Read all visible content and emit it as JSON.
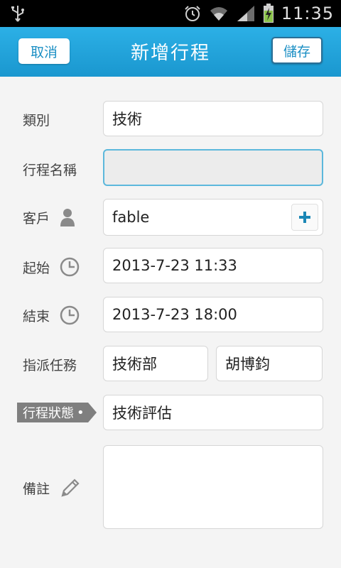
{
  "status_bar": {
    "time": "11:35",
    "icons": [
      "usb-icon",
      "alarm-icon",
      "wifi-icon",
      "signal-icon",
      "battery-charging-icon"
    ]
  },
  "action_bar": {
    "cancel_label": "取消",
    "title": "新增行程",
    "save_label": "儲存"
  },
  "form": {
    "category": {
      "label": "類別",
      "value": "技術"
    },
    "schedule_name": {
      "label": "行程名稱",
      "value": ""
    },
    "client": {
      "label": "客戶",
      "value": "fable"
    },
    "start": {
      "label": "起始",
      "value": "2013-7-23 11:33"
    },
    "end": {
      "label": "結束",
      "value": "2013-7-23 18:00"
    },
    "assignment": {
      "label": "指派任務",
      "department": "技術部",
      "person": "胡博鈞"
    },
    "status": {
      "label": "行程狀態",
      "value": "技術評估"
    },
    "notes": {
      "label": "備註",
      "value": ""
    }
  },
  "colors": {
    "action_bar": "#1f9fd8",
    "accent": "#1b8fc4",
    "status_tag": "#7f7f7f"
  }
}
